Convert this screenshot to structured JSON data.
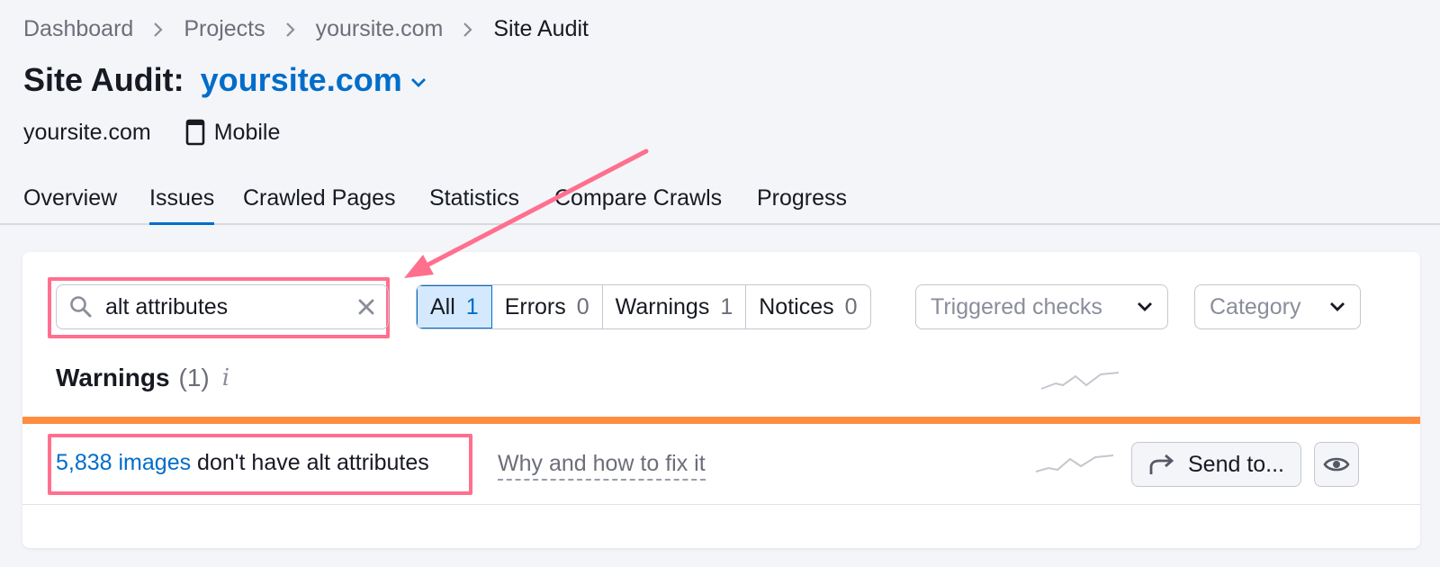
{
  "breadcrumb": {
    "items": [
      "Dashboard",
      "Projects",
      "yoursite.com"
    ],
    "current": "Site Audit"
  },
  "header": {
    "title": "Site Audit:",
    "domain": "yoursite.com"
  },
  "meta": {
    "site": "yoursite.com",
    "device": "Mobile"
  },
  "tabs": [
    "Overview",
    "Issues",
    "Crawled Pages",
    "Statistics",
    "Compare Crawls",
    "Progress"
  ],
  "active_tab": "Issues",
  "filters": {
    "search_value": "alt attributes",
    "segments": [
      {
        "label": "All",
        "count": "1"
      },
      {
        "label": "Errors",
        "count": "0"
      },
      {
        "label": "Warnings",
        "count": "1"
      },
      {
        "label": "Notices",
        "count": "0"
      }
    ],
    "triggered_checks": "Triggered checks",
    "category": "Category"
  },
  "section": {
    "title": "Warnings",
    "count": "(1)",
    "info": "i"
  },
  "issue": {
    "link_text": "5,838 images",
    "text": " don't have alt attributes",
    "why": "Why and how to fix it",
    "send_to": "Send to..."
  },
  "colors": {
    "accent": "#006dca",
    "highlight": "#ff6f8e",
    "warning_bar": "#ff8c3f"
  }
}
